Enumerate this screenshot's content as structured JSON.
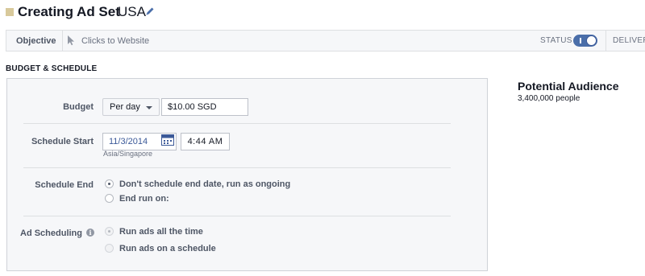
{
  "header": {
    "title": "Creating Ad Set",
    "country": "USA"
  },
  "objective_bar": {
    "label": "Objective",
    "value": "Clicks to Website",
    "status_label": "STATUS",
    "status_on": true,
    "delivery_label": "DELIVERY"
  },
  "section": {
    "heading": "BUDGET & SCHEDULE"
  },
  "budget": {
    "label": "Budget",
    "period_selected": "Per day",
    "amount": "$10.00 SGD"
  },
  "schedule_start": {
    "label": "Schedule Start",
    "date": "11/3/2014",
    "time": "4:44 AM",
    "timezone": "Asia/Singapore"
  },
  "schedule_end": {
    "label": "Schedule End",
    "options": [
      {
        "label": "Don't schedule end date, run as ongoing",
        "checked": true
      },
      {
        "label": "End run on:",
        "checked": false
      }
    ]
  },
  "ad_scheduling": {
    "label": "Ad Scheduling",
    "options": [
      {
        "label": "Run ads all the time",
        "checked": true
      },
      {
        "label": "Run ads on a schedule",
        "checked": false
      }
    ]
  },
  "audience": {
    "title": "Potential Audience",
    "value": "3,400,000 people"
  },
  "colors": {
    "brand": "#3b5998",
    "toggle": "#4a6ea9",
    "panel_bg": "#f6f7f9"
  }
}
